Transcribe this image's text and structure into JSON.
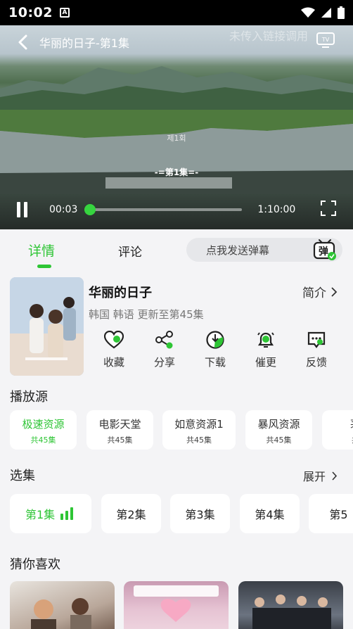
{
  "status_bar": {
    "time": "10:02",
    "notification_icon": "A"
  },
  "player": {
    "title": "华丽的日子-第1集",
    "watermark": "未传入链接调用",
    "subtitle_korean": "제1회",
    "subtitle_episode": "-=第1集=-",
    "current_time": "00:03",
    "duration": "1:10:00",
    "progress_fraction": 0.01,
    "accent_color": "#36d43f"
  },
  "tabs": {
    "detail": "详情",
    "comment": "评论",
    "danmu_placeholder": "点我发送弹幕",
    "danmu_badge": "弹"
  },
  "show": {
    "title": "华丽的日子",
    "meta": "韩国 韩语 更新至第45集",
    "intro_label": "简介"
  },
  "actions": [
    {
      "label": "收藏",
      "icon": "heart-icon"
    },
    {
      "label": "分享",
      "icon": "share-icon"
    },
    {
      "label": "下载",
      "icon": "download-icon"
    },
    {
      "label": "催更",
      "icon": "bell-icon"
    },
    {
      "label": "反馈",
      "icon": "feedback-icon"
    }
  ],
  "sources": {
    "title": "播放源",
    "items": [
      {
        "name": "极速资源",
        "count": "共45集"
      },
      {
        "name": "电影天堂",
        "count": "共45集"
      },
      {
        "name": "如意资源1",
        "count": "共45集"
      },
      {
        "name": "暴风资源",
        "count": "共45集"
      },
      {
        "name": "茅",
        "count": "共"
      }
    ]
  },
  "episodes": {
    "title": "选集",
    "expand_label": "展开",
    "items": [
      "第1集",
      "第2集",
      "第3集",
      "第4集",
      "第5"
    ]
  },
  "recommend": {
    "title": "猜你喜欢"
  },
  "theme": {
    "green": "#2ec535",
    "background": "#f4f4f6"
  }
}
